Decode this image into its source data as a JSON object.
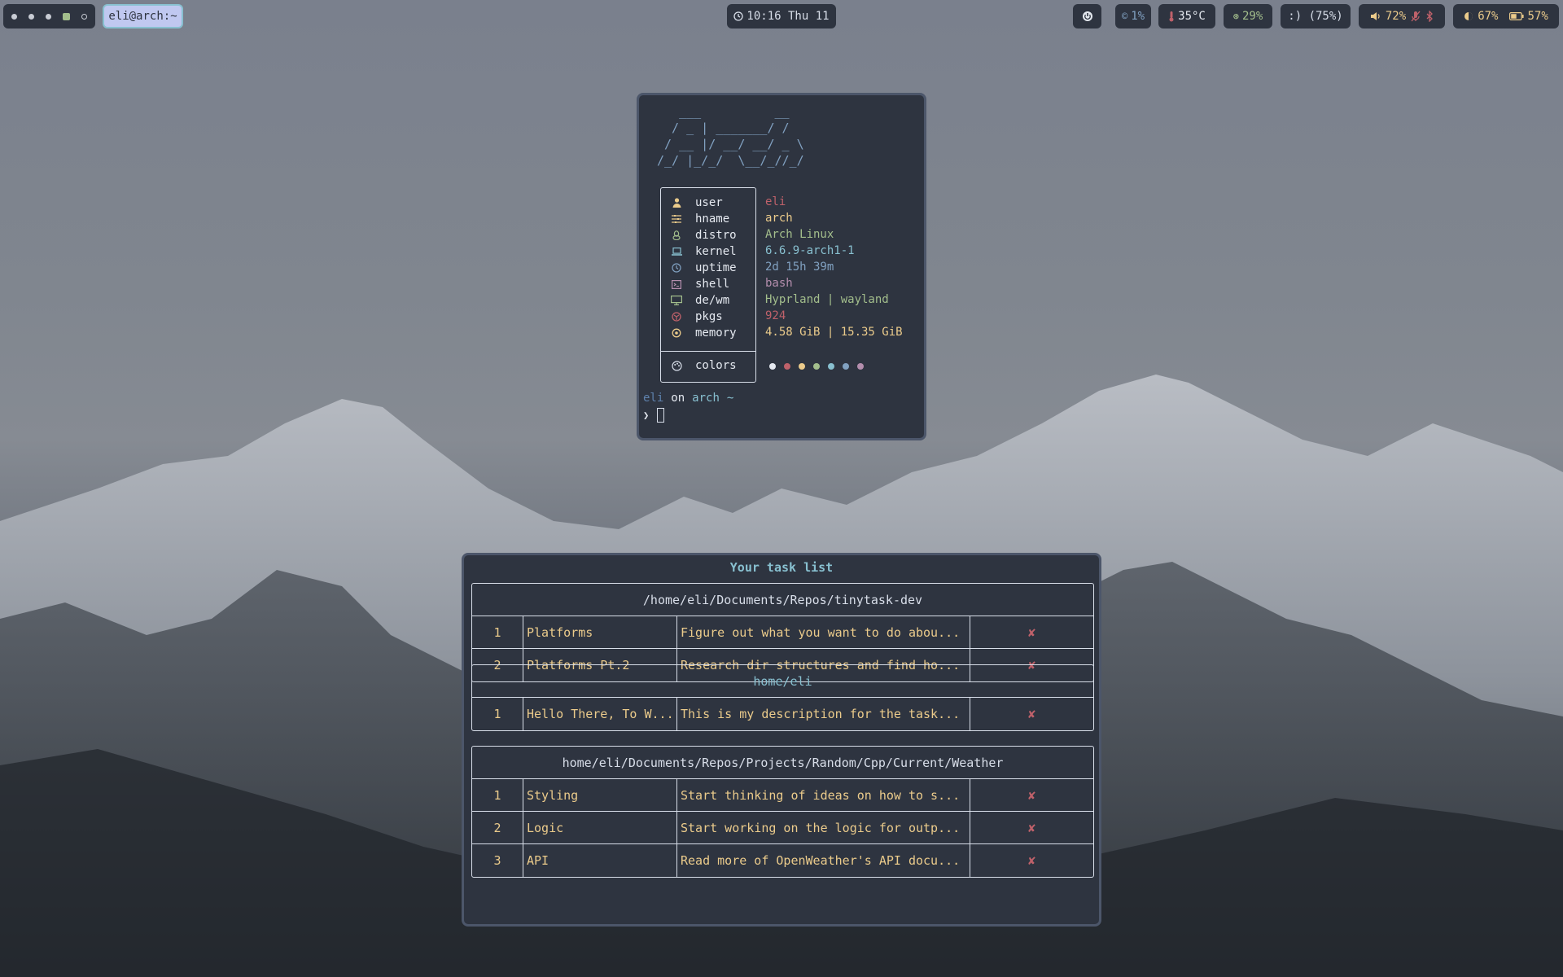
{
  "topbar": {
    "workspaces": [
      "ws-1",
      "ws-2",
      "ws-3",
      "ws-4-active",
      "ws-5-empty"
    ],
    "window_title": "eli@arch:~",
    "clock": "10:16 Thu 11",
    "cpu": "1%",
    "temperature": "35°C",
    "memory": "29%",
    "mood": ":) (75%)",
    "volume": "72%",
    "brightness": "67%",
    "battery": "57%",
    "icons": {
      "power": "power-icon",
      "cpu": "cpu-icon",
      "temperature": "thermometer-icon",
      "memory": "memory-icon",
      "volume": "speaker-icon",
      "mic": "mic-muted-icon",
      "bluetooth": "bluetooth-icon",
      "brightness": "brightness-icon",
      "battery": "battery-icon"
    }
  },
  "terminal": {
    "ascii_art": "   ___          __\n  / _ | _______/ /\n / __ |/ __/ __/ _ \\\n/_/ |_/_/  \\__/_//_/",
    "fields": [
      {
        "icon": "user-icon",
        "label": "user",
        "value": "eli",
        "color": "#bf616a"
      },
      {
        "icon": "hostname-icon",
        "label": "hname",
        "value": "arch",
        "color": "#ebcb8b"
      },
      {
        "icon": "distro-icon",
        "label": "distro",
        "value": "Arch Linux",
        "color": "#a3be8c"
      },
      {
        "icon": "laptop-icon",
        "label": "kernel",
        "value": "6.6.9-arch1-1",
        "color": "#88c0d0"
      },
      {
        "icon": "clock-icon",
        "label": "uptime",
        "value": "2d 15h 39m",
        "color": "#81a1c1"
      },
      {
        "icon": "terminal-icon",
        "label": "shell",
        "value": "bash",
        "color": "#b48ead"
      },
      {
        "icon": "monitor-icon",
        "label": "de/wm",
        "value": "Hyprland | wayland",
        "color": "#a3be8c"
      },
      {
        "icon": "package-icon",
        "label": "pkgs",
        "value": "924",
        "color": "#bf616a"
      },
      {
        "icon": "memory-chip-icon",
        "label": "memory",
        "value": "4.58 GiB | 15.35 GiB",
        "color": "#ebcb8b"
      }
    ],
    "colors_label": "colors",
    "palette": [
      "#e5e9f0",
      "#bf616a",
      "#ebcb8b",
      "#a3be8c",
      "#88c0d0",
      "#81a1c1",
      "#b48ead"
    ],
    "prompt": {
      "user": "eli",
      "on": "on",
      "host": "arch",
      "path": "~",
      "symbol": "❯"
    }
  },
  "tasklist": {
    "title": "Your task list",
    "delete_symbol": "✘",
    "groups": [
      {
        "path": "/home/eli/Documents/Repos/tinytask-dev",
        "tasks": [
          {
            "num": "1",
            "name": "Platforms",
            "desc": "Figure out what you want to do abou..."
          },
          {
            "num": "2",
            "name": "Platforms Pt.2",
            "desc": "Research dir structures and find ho..."
          }
        ]
      },
      {
        "path": "home/eli",
        "tasks": [
          {
            "num": "1",
            "name": "Hello There, To W...",
            "desc": "This is my description for the task..."
          }
        ]
      },
      {
        "path": "home/eli/Documents/Repos/Projects/Random/Cpp/Current/Weather",
        "tasks": [
          {
            "num": "1",
            "name": "Styling",
            "desc": "Start thinking of ideas on how to s..."
          },
          {
            "num": "2",
            "name": "Logic",
            "desc": "Start working on the logic for outp..."
          },
          {
            "num": "3",
            "name": "API",
            "desc": "Read more of OpenWeather's API docu..."
          }
        ]
      }
    ]
  }
}
